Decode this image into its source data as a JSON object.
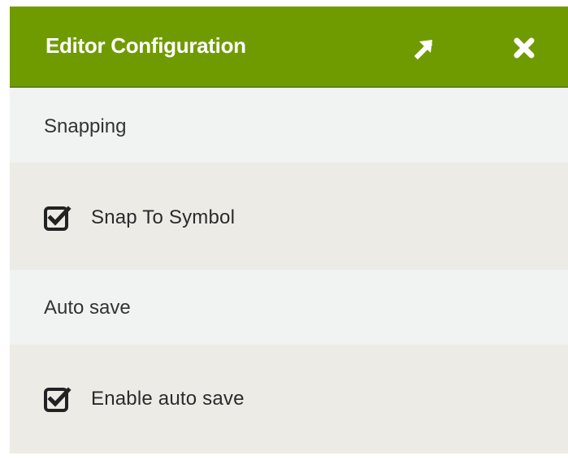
{
  "dialog": {
    "title": "Editor Configuration",
    "header_color": "#709b00",
    "buttons": {
      "expand_icon": "arrow-up-right-icon",
      "close_icon": "close-icon"
    }
  },
  "sections": [
    {
      "title": "Snapping",
      "options": [
        {
          "label": "Snap To Symbol",
          "checked": true
        }
      ]
    },
    {
      "title": "Auto save",
      "options": [
        {
          "label": "Enable auto save",
          "checked": true
        }
      ]
    }
  ]
}
